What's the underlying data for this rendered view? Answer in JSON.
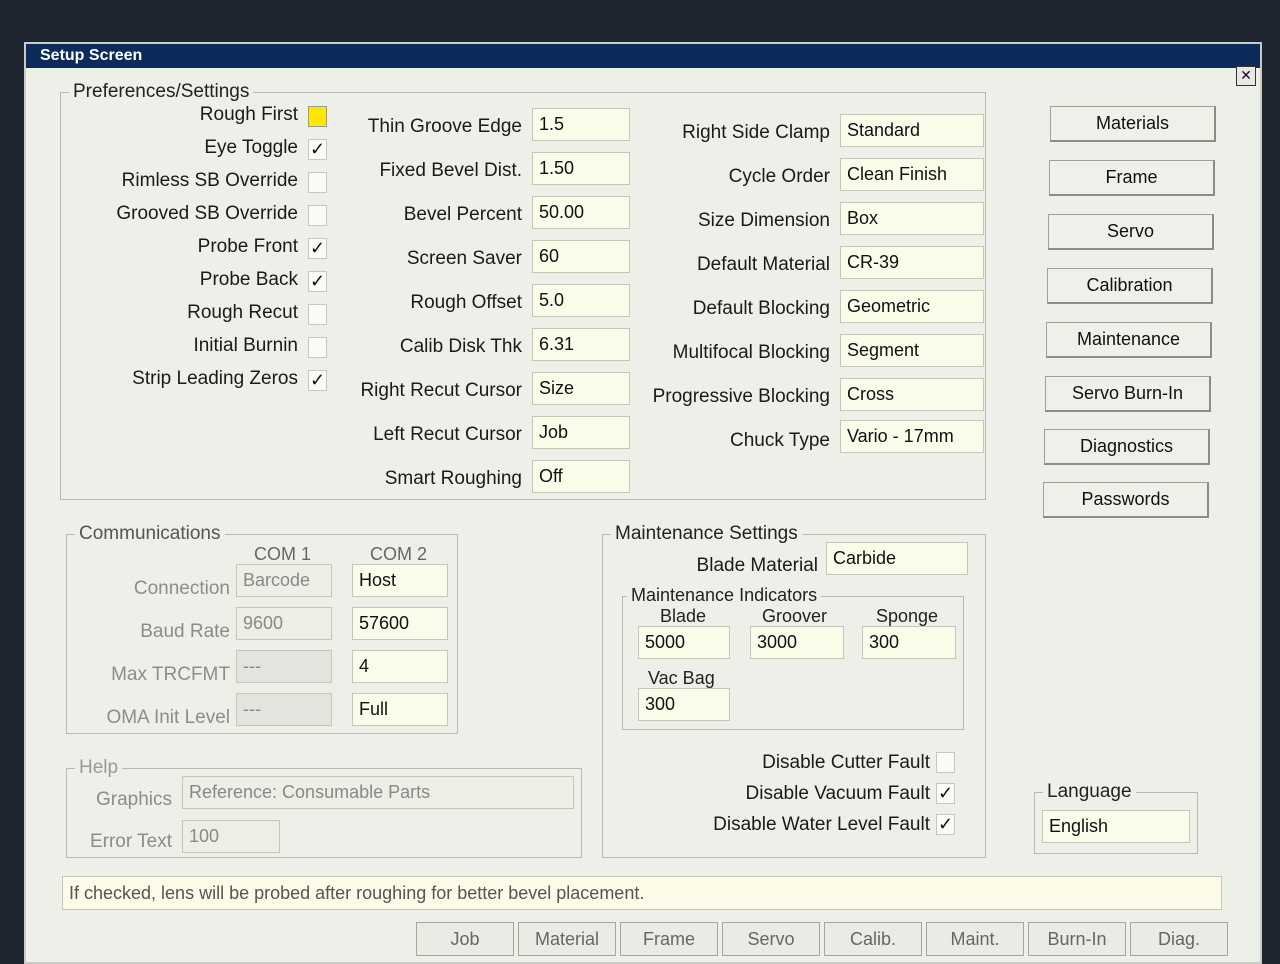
{
  "window": {
    "title": "Setup Screen",
    "close_label": "✕"
  },
  "preferences": {
    "title": "Preferences/Settings",
    "checkboxes": [
      {
        "label": "Rough First",
        "checked": "",
        "highlight": "#ffe600"
      },
      {
        "label": "Eye Toggle",
        "checked": "✓"
      },
      {
        "label": "Rimless SB Override",
        "checked": ""
      },
      {
        "label": "Grooved SB Override",
        "checked": ""
      },
      {
        "label": "Probe Front",
        "checked": "✓"
      },
      {
        "label": "Probe Back",
        "checked": "✓"
      },
      {
        "label": "Rough Recut",
        "checked": ""
      },
      {
        "label": "Initial Burnin",
        "checked": ""
      },
      {
        "label": "Strip Leading Zeros",
        "checked": "✓"
      }
    ],
    "middle": [
      {
        "label": "Thin Groove Edge",
        "value": "1.5"
      },
      {
        "label": "Fixed Bevel Dist.",
        "value": "1.50"
      },
      {
        "label": "Bevel Percent",
        "value": "50.00"
      },
      {
        "label": "Screen Saver",
        "value": "60"
      },
      {
        "label": "Rough Offset",
        "value": "5.0"
      },
      {
        "label": "Calib Disk Thk",
        "value": "6.31"
      },
      {
        "label": "Right Recut Cursor",
        "value": "Size"
      },
      {
        "label": "Left Recut Cursor",
        "value": "Job"
      },
      {
        "label": "Smart Roughing",
        "value": "Off"
      }
    ],
    "right": [
      {
        "label": "Right Side Clamp",
        "value": "Standard"
      },
      {
        "label": "Cycle Order",
        "value": "Clean Finish"
      },
      {
        "label": "Size Dimension",
        "value": "Box"
      },
      {
        "label": "Default Material",
        "value": "CR-39"
      },
      {
        "label": "Default Blocking",
        "value": "Geometric"
      },
      {
        "label": "Multifocal Blocking",
        "value": "Segment"
      },
      {
        "label": "Progressive Blocking",
        "value": "Cross"
      },
      {
        "label": "Chuck Type",
        "value": "Vario - 17mm"
      }
    ]
  },
  "side_buttons": [
    "Materials",
    "Frame",
    "Servo",
    "Calibration",
    "Maintenance",
    "Servo Burn-In",
    "Diagnostics",
    "Passwords"
  ],
  "communications": {
    "title": "Communications",
    "col1": "COM 1",
    "col2": "COM 2",
    "rows": [
      {
        "label": "Connection",
        "com1": "Barcode",
        "com2": "Host"
      },
      {
        "label": "Baud Rate",
        "com1": "9600",
        "com2": "57600"
      },
      {
        "label": "Max TRCFMT",
        "com1": "---",
        "com2": "4"
      },
      {
        "label": "OMA Init Level",
        "com1": "---",
        "com2": "Full"
      }
    ]
  },
  "maintenance": {
    "title": "Maintenance Settings",
    "blade_material_label": "Blade Material",
    "blade_material_value": "Carbide",
    "indicators_title": "Maintenance Indicators",
    "blade_label": "Blade",
    "blade_value": "5000",
    "groover_label": "Groover",
    "groover_value": "3000",
    "sponge_label": "Sponge",
    "sponge_value": "300",
    "vacbag_label": "Vac Bag",
    "vacbag_value": "300",
    "faults": [
      {
        "label": "Disable Cutter Fault",
        "checked": ""
      },
      {
        "label": "Disable Vacuum Fault",
        "checked": "✓"
      },
      {
        "label": "Disable Water Level Fault",
        "checked": "✓"
      }
    ]
  },
  "help": {
    "title": "Help",
    "graphics_label": "Graphics",
    "graphics_value": "Reference: Consumable Parts",
    "error_label": "Error Text",
    "error_value": "100"
  },
  "language": {
    "title": "Language",
    "value": "English"
  },
  "status_text": "If checked, lens will be probed after roughing for better bevel placement.",
  "tabs": [
    "Job",
    "Material",
    "Frame",
    "Servo",
    "Calib.",
    "Maint.",
    "Burn-In",
    "Diag."
  ]
}
